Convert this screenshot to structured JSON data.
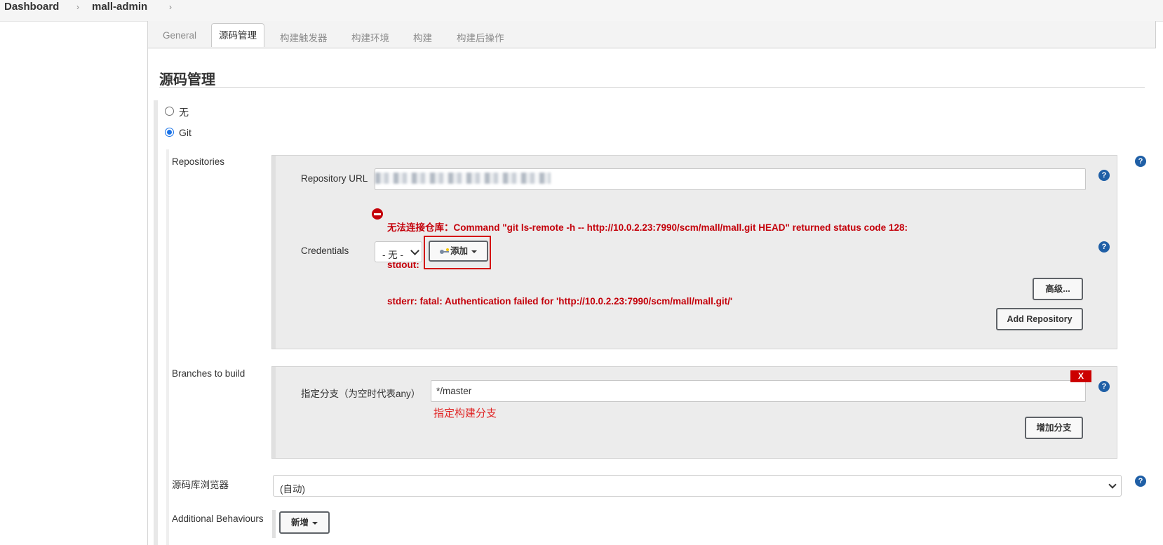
{
  "breadcrumb": {
    "items": [
      "Dashboard",
      "mall-admin"
    ]
  },
  "tabs": [
    {
      "label": "General",
      "active": false
    },
    {
      "label": "源码管理",
      "active": true
    },
    {
      "label": "构建触发器",
      "active": false
    },
    {
      "label": "构建环境",
      "active": false
    },
    {
      "label": "构建",
      "active": false
    },
    {
      "label": "构建后操作",
      "active": false
    }
  ],
  "section": {
    "title": "源码管理",
    "scm_options": [
      {
        "label": "无",
        "checked": false
      },
      {
        "label": "Git",
        "checked": true
      }
    ]
  },
  "repositories": {
    "label": "Repositories",
    "url_label": "Repository URL",
    "url_value": "",
    "error_lines": [
      "无法连接仓库：Command \"git ls-remote -h -- http://10.0.2.23:7990/scm/mall/mall.git HEAD\" returned status code 128:",
      "stdout:",
      "stderr: fatal: Authentication failed for 'http://10.0.2.23:7990/scm/mall/mall.git/'"
    ],
    "credentials_label": "Credentials",
    "credentials_selected": "- 无 -",
    "add_label": "添加",
    "advanced_label": "高级...",
    "add_repository_label": "Add Repository"
  },
  "branches": {
    "label": "Branches to build",
    "field_label": "指定分支（为空时代表any）",
    "field_value": "*/master",
    "delete_label": "X",
    "annotation": "指定构建分支",
    "add_branch_label": "增加分支"
  },
  "browser": {
    "label": "源码库浏览器",
    "selected": "(自动)"
  },
  "behaviours": {
    "label": "Additional Behaviours",
    "add_label": "新增"
  },
  "help_label": "?",
  "colors": {
    "error": "#c4000a",
    "highlight": "#d40000",
    "annotation": "#e02020",
    "help": "#1f5fa6",
    "radio_accent": "#1a73e8"
  },
  "icons": [
    "chevron-right-icon",
    "error-icon",
    "key-icon",
    "caret-down-icon",
    "help-icon",
    "radio-button"
  ]
}
